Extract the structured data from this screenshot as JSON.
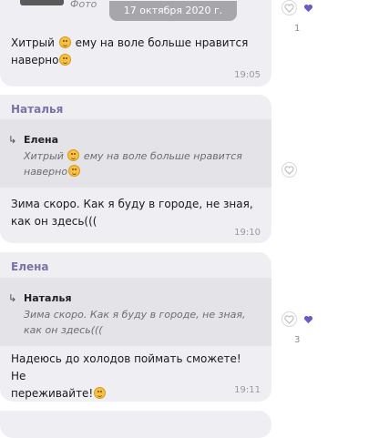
{
  "chat": {
    "top_image_caption": "Фото",
    "date_badge": "17 октября 2020 г.",
    "messages": [
      {
        "text_part1": "Хитрый",
        "text_part2": "ему на воле больше нравится",
        "text_part3": "наверно",
        "time": "19:05",
        "like_count": "1"
      },
      {
        "sender": "Наталья",
        "quote_author": "Елена",
        "quote_text_part1": "Хитрый",
        "quote_text_part2": "ему на воле больше нравится",
        "quote_text_part3": "наверно",
        "text_line1": "Зима скоро. Как я буду в городе, не зная,",
        "text_line2": "как он здесь(((",
        "time": "19:10"
      },
      {
        "sender": "Елена",
        "quote_author": "Наталья",
        "quote_text_line1": "Зима скоро. Как я буду в городе, не зная,",
        "quote_text_line2": "как он здесь(((",
        "text_line1": "Надеюсь до холодов поймать сможете! Не",
        "text_line2": "переживайте!",
        "time": "19:11",
        "like_count": "3"
      }
    ]
  },
  "colors": {
    "accent": "#7d71a6",
    "heart_filled": "#6a5ac6",
    "bubble_bg": "#efeff3",
    "quote_bg": "#e3e3e8"
  },
  "icons": {
    "like": "heart-outline-icon",
    "liked": "heart-filled-icon",
    "reply": "reply-arrow-icon",
    "emoji_smile": "smile-emoji-icon",
    "emoji_tongue": "tongue-emoji-icon"
  }
}
